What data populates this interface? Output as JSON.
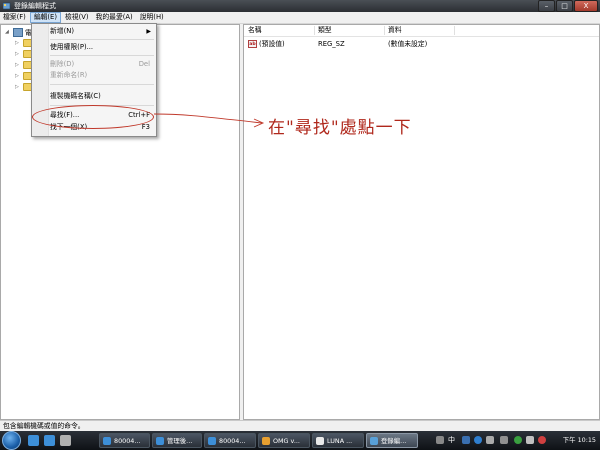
{
  "window": {
    "title": "登錄編輯程式",
    "minimize": "–",
    "maximize": "□",
    "close": "X"
  },
  "menubar": {
    "items": [
      "檔案(F)",
      "編輯(E)",
      "檢視(V)",
      "我的最愛(A)",
      "說明(H)"
    ]
  },
  "tree": {
    "root_label": "電"
  },
  "list": {
    "headers": {
      "name": "名稱",
      "type": "類型",
      "data": "資料"
    },
    "rows": [
      {
        "icon": "ab",
        "name": "(預設值)",
        "type": "REG_SZ",
        "data": "(數值未設定)"
      }
    ]
  },
  "edit_menu": {
    "items": [
      {
        "label": "新增(N)",
        "shortcut": "",
        "disabled": false,
        "submenu": true
      },
      {
        "label": "使用權限(P)...",
        "shortcut": "",
        "disabled": false
      },
      {
        "label": "刪除(D)",
        "shortcut": "Del",
        "disabled": true
      },
      {
        "label": "重新命名(R)",
        "shortcut": "",
        "disabled": true
      },
      {
        "label": "複製機碼名稱(C)",
        "shortcut": "",
        "disabled": false
      },
      {
        "label": "尋找(F)...",
        "shortcut": "Ctrl+F",
        "disabled": false
      },
      {
        "label": "找下一個(X)",
        "shortcut": "F3",
        "disabled": false
      }
    ],
    "submenu_arrow": "▶"
  },
  "annotation": {
    "text": "在\"尋找\"處點一下",
    "color": "#b0281c"
  },
  "status": {
    "text": "包含編輯機碼或值的命令。"
  },
  "taskbar": {
    "buttons": [
      {
        "label": "80004...",
        "icon_color": "#3d8fd8"
      },
      {
        "label": "管理後...",
        "icon_color": "#3d8fd8"
      },
      {
        "label": "80004...",
        "icon_color": "#3d8fd8"
      },
      {
        "label": "OMG v...",
        "icon_color": "#e8a030"
      },
      {
        "label": "LUNA ...",
        "icon_color": "#e8e8e8"
      },
      {
        "label": "登錄編...",
        "icon_color": "#58a0d8",
        "active": true
      }
    ],
    "language": "中",
    "clock": "下午 10:15"
  },
  "colors": {
    "titlebar": "#3a3e44",
    "menu_highlight": "#cfe3f7",
    "annotation": "#b0281c"
  }
}
